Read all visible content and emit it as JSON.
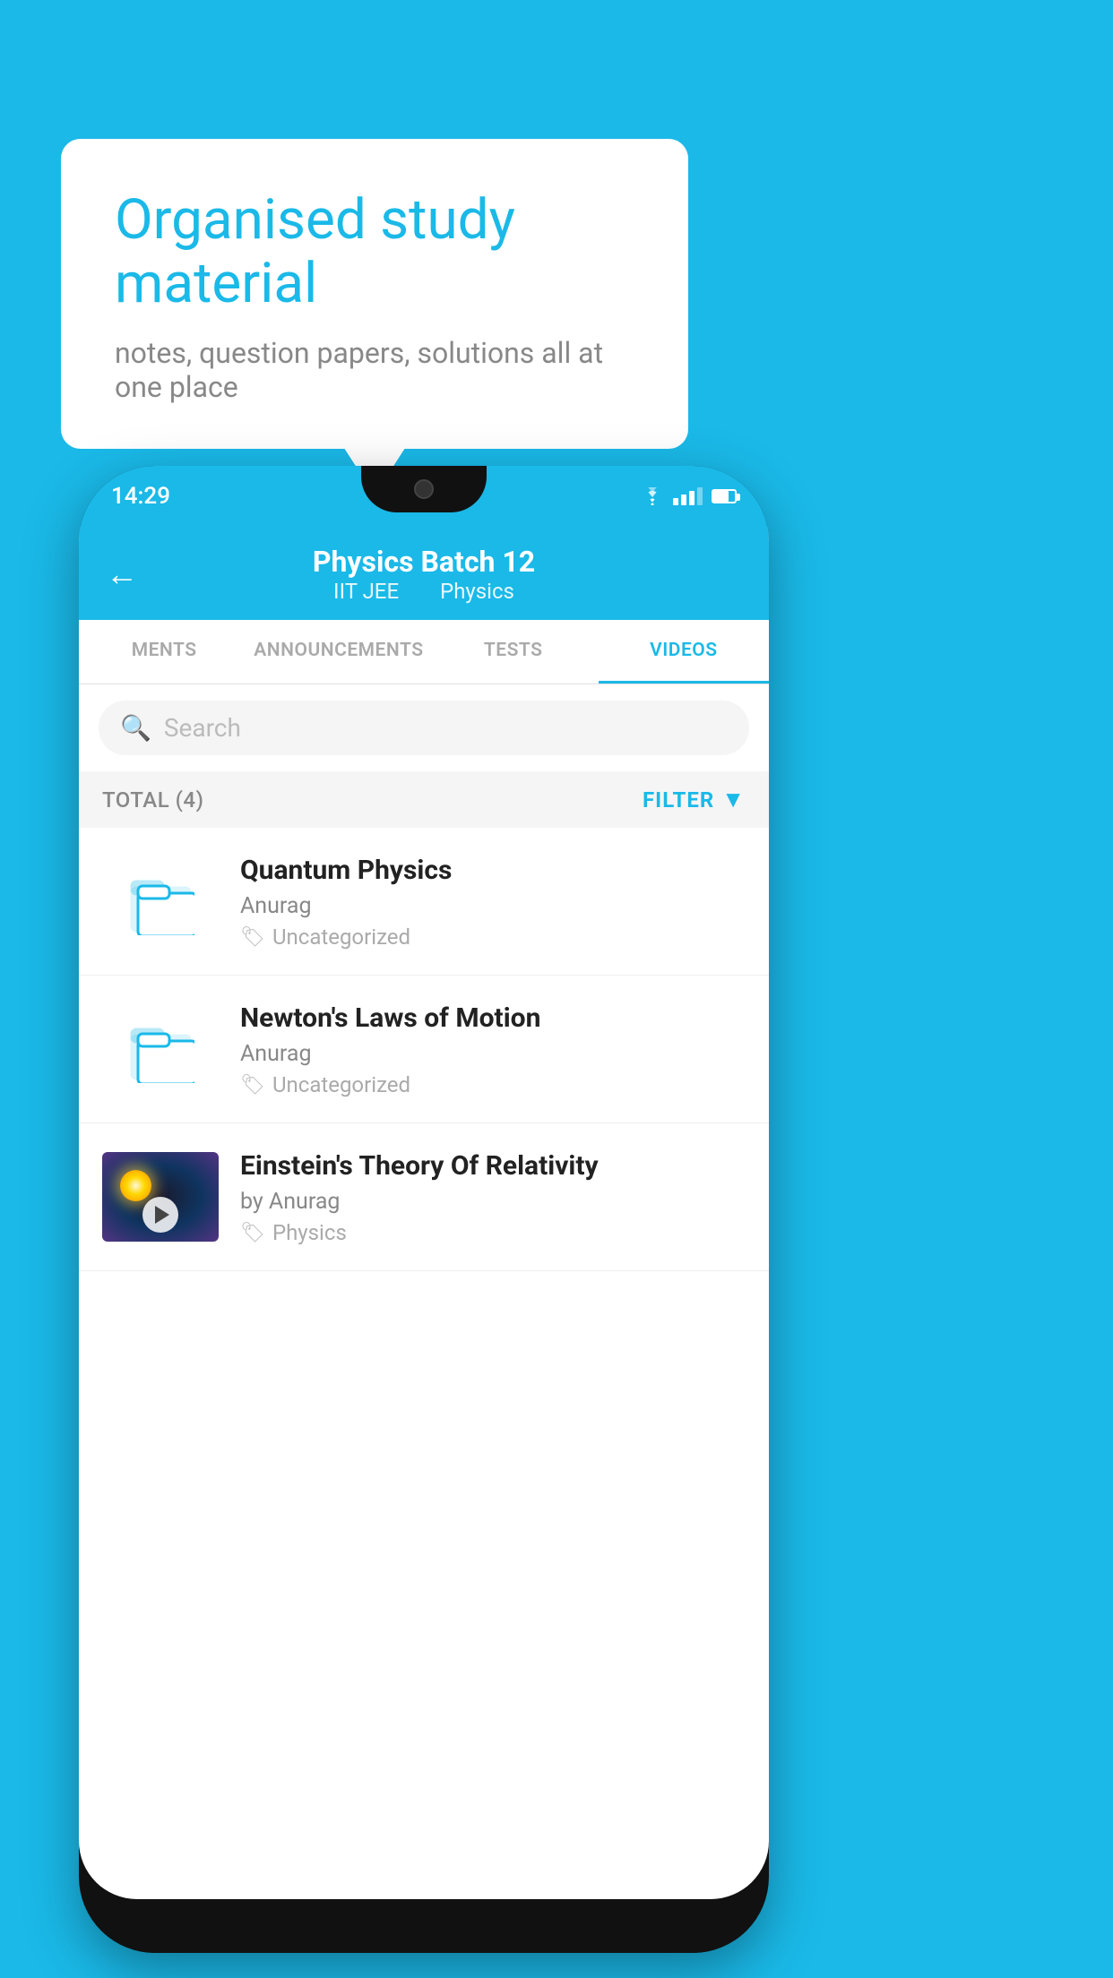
{
  "background_color": "#1ab9e8",
  "speech_bubble": {
    "title": "Organised study material",
    "subtitle": "notes, question papers, solutions all at one place"
  },
  "phone": {
    "status_bar": {
      "time": "14:29"
    },
    "app_header": {
      "back_label": "←",
      "title": "Physics Batch 12",
      "subtitle_left": "IIT JEE",
      "subtitle_right": "Physics"
    },
    "tabs": [
      {
        "label": "MENTS",
        "active": false
      },
      {
        "label": "ANNOUNCEMENTS",
        "active": false
      },
      {
        "label": "TESTS",
        "active": false
      },
      {
        "label": "VIDEOS",
        "active": true
      }
    ],
    "search": {
      "placeholder": "Search"
    },
    "filter_bar": {
      "total_label": "TOTAL (4)",
      "filter_label": "FILTER"
    },
    "video_items": [
      {
        "id": 1,
        "title": "Quantum Physics",
        "author": "Anurag",
        "tag": "Uncategorized",
        "has_thumbnail": false
      },
      {
        "id": 2,
        "title": "Newton's Laws of Motion",
        "author": "Anurag",
        "tag": "Uncategorized",
        "has_thumbnail": false
      },
      {
        "id": 3,
        "title": "Einstein's Theory Of Relativity",
        "author": "by Anurag",
        "tag": "Physics",
        "has_thumbnail": true
      }
    ]
  }
}
